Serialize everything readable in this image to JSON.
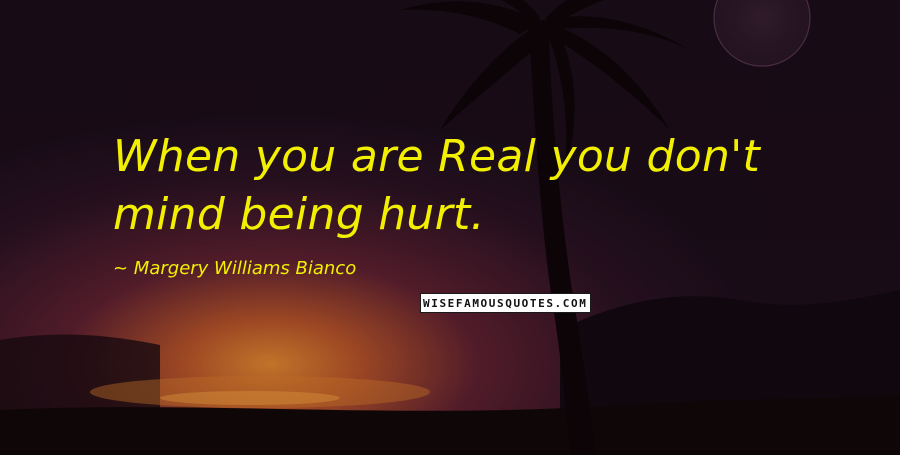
{
  "quote": {
    "text": "When you are Real you don't mind being hurt.",
    "author_line": "~ Margery Williams Bianco",
    "text_color": "#f2f000"
  },
  "watermark": {
    "text": "WISEFAMOUSQUOTES.COM"
  },
  "background": {
    "description_colors": {
      "sky": "#1b0d1a",
      "glow": "#e0802a",
      "silhouette": "#0e0508"
    },
    "elements": [
      "palm-tree-silhouette",
      "moon",
      "sunset-sea",
      "hills"
    ]
  }
}
